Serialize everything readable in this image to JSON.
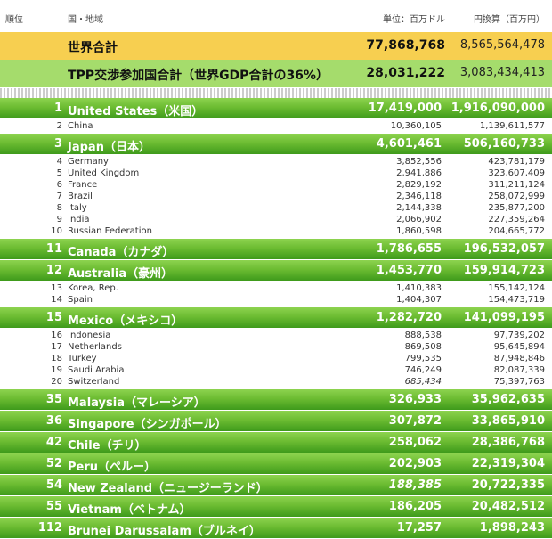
{
  "header": {
    "rank": "順位",
    "country": "国・地域",
    "usd": "単位：百万ドル",
    "jpy": "円換算（百万円）"
  },
  "world_total": {
    "label": "世界合計",
    "usd": "77,868,768",
    "jpy": "8,565,564,478"
  },
  "tpp_total": {
    "label": "TPP交渉参加国合計（世界GDP合計の36%）",
    "usd": "28,031,222",
    "jpy": "3,083,434,413"
  },
  "rows": [
    {
      "rank": "1",
      "name": "United States（米国）",
      "usd": "17,419,000",
      "jpy": "1,916,090,000",
      "tpp": true
    },
    {
      "rank": "2",
      "name": "China",
      "usd": "10,360,105",
      "jpy": "1,139,611,577",
      "tpp": false
    },
    {
      "rank": "3",
      "name": "Japan（日本）",
      "usd": "4,601,461",
      "jpy": "506,160,733",
      "tpp": true
    },
    {
      "rank": "4",
      "name": "Germany",
      "usd": "3,852,556",
      "jpy": "423,781,179",
      "tpp": false
    },
    {
      "rank": "5",
      "name": "United Kingdom",
      "usd": "2,941,886",
      "jpy": "323,607,409",
      "tpp": false
    },
    {
      "rank": "6",
      "name": "France",
      "usd": "2,829,192",
      "jpy": "311,211,124",
      "tpp": false
    },
    {
      "rank": "7",
      "name": "Brazil",
      "usd": "2,346,118",
      "jpy": "258,072,999",
      "tpp": false
    },
    {
      "rank": "8",
      "name": "Italy",
      "usd": "2,144,338",
      "jpy": "235,877,200",
      "tpp": false
    },
    {
      "rank": "9",
      "name": "India",
      "usd": "2,066,902",
      "jpy": "227,359,264",
      "tpp": false
    },
    {
      "rank": "10",
      "name": "Russian Federation",
      "usd": "1,860,598",
      "jpy": "204,665,772",
      "tpp": false
    },
    {
      "rank": "11",
      "name": "Canada（カナダ）",
      "usd": "1,786,655",
      "jpy": "196,532,057",
      "tpp": true
    },
    {
      "rank": "12",
      "name": "Australia（豪州）",
      "usd": "1,453,770",
      "jpy": "159,914,723",
      "tpp": true
    },
    {
      "rank": "13",
      "name": "Korea, Rep.",
      "usd": "1,410,383",
      "jpy": "155,142,124",
      "tpp": false
    },
    {
      "rank": "14",
      "name": "Spain",
      "usd": "1,404,307",
      "jpy": "154,473,719",
      "tpp": false
    },
    {
      "rank": "15",
      "name": "Mexico（メキシコ）",
      "usd": "1,282,720",
      "jpy": "141,099,195",
      "tpp": true
    },
    {
      "rank": "16",
      "name": "Indonesia",
      "usd": "888,538",
      "jpy": "97,739,202",
      "tpp": false
    },
    {
      "rank": "17",
      "name": "Netherlands",
      "usd": "869,508",
      "jpy": "95,645,894",
      "tpp": false
    },
    {
      "rank": "18",
      "name": "Turkey",
      "usd": "799,535",
      "jpy": "87,948,846",
      "tpp": false
    },
    {
      "rank": "19",
      "name": "Saudi Arabia",
      "usd": "746,249",
      "jpy": "82,087,339",
      "tpp": false
    },
    {
      "rank": "20",
      "name": "Switzerland",
      "usd": "685,434",
      "jpy": "75,397,763",
      "tpp": false,
      "italic": true
    },
    {
      "rank": "35",
      "name": "Malaysia（マレーシア）",
      "usd": "326,933",
      "jpy": "35,962,635",
      "tpp": true
    },
    {
      "rank": "36",
      "name": "Singapore（シンガポール）",
      "usd": "307,872",
      "jpy": "33,865,910",
      "tpp": true
    },
    {
      "rank": "42",
      "name": "Chile（チリ）",
      "usd": "258,062",
      "jpy": "28,386,768",
      "tpp": true
    },
    {
      "rank": "52",
      "name": "Peru（ペルー）",
      "usd": "202,903",
      "jpy": "22,319,304",
      "tpp": true
    },
    {
      "rank": "54",
      "name": "New Zealand（ニュージーランド）",
      "usd": "188,385",
      "jpy": "20,722,335",
      "tpp": true,
      "italic": true
    },
    {
      "rank": "55",
      "name": "Vietnam（ベトナム）",
      "usd": "186,205",
      "jpy": "20,482,512",
      "tpp": true
    },
    {
      "rank": "112",
      "name": "Brunei Darussalam（ブルネイ）",
      "usd": "17,257",
      "jpy": "1,898,243",
      "tpp": true
    }
  ]
}
